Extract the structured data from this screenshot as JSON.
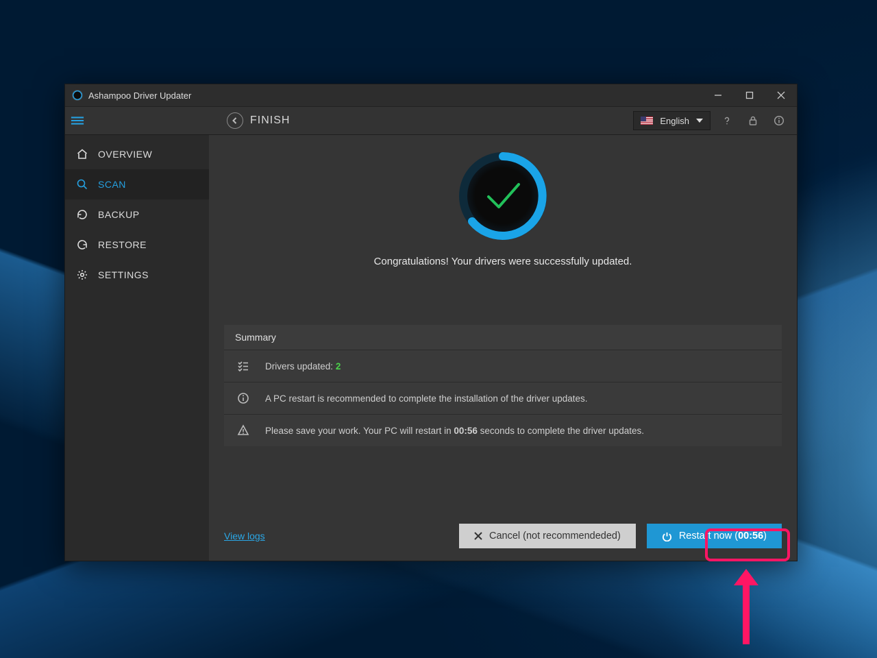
{
  "titlebar": {
    "title": "Ashampoo Driver Updater"
  },
  "topbar": {
    "breadcrumb": "FINISH",
    "language": "English"
  },
  "sidebar": {
    "items": [
      {
        "label": "OVERVIEW"
      },
      {
        "label": "SCAN"
      },
      {
        "label": "BACKUP"
      },
      {
        "label": "RESTORE"
      },
      {
        "label": "SETTINGS"
      }
    ]
  },
  "hero": {
    "message": "Congratulations! Your drivers were successfully updated."
  },
  "summary": {
    "heading": "Summary",
    "row1_label": "Drivers updated: ",
    "row1_value": "2",
    "row2": "A PC restart is recommended to complete the installation of the driver updates.",
    "row3_before": "Please save your work. Your PC will restart in ",
    "row3_time": "00:56",
    "row3_after": " seconds to complete the driver updates."
  },
  "footer": {
    "view_logs": "View logs",
    "cancel_label": "Cancel (not recommendeded)",
    "restart_prefix": "Restart now (",
    "restart_time": "00:56",
    "restart_suffix": ")"
  }
}
